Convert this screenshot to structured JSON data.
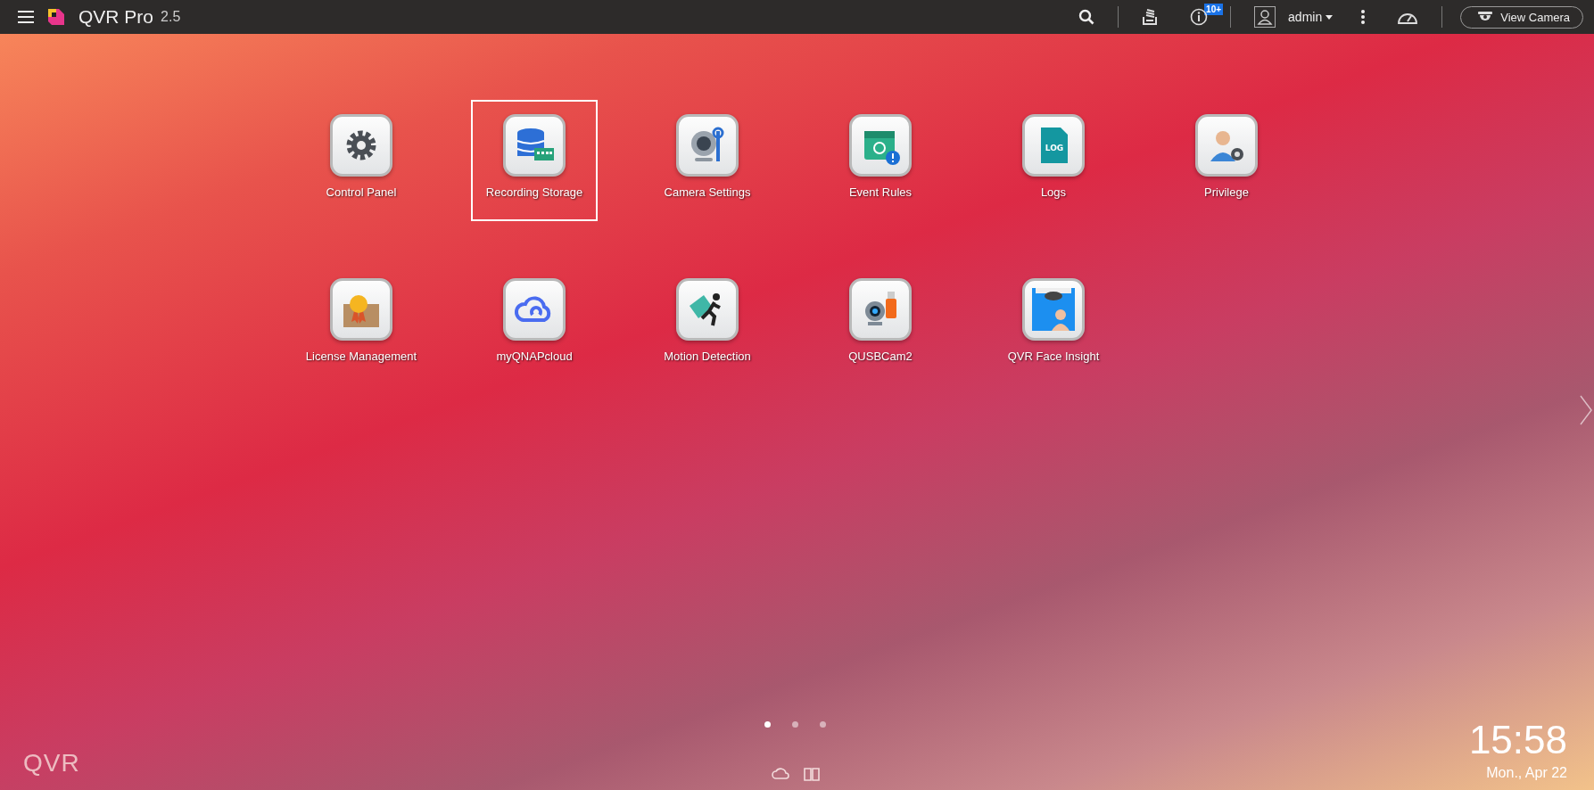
{
  "topbar": {
    "app_name": "QVR Pro",
    "version": "2.5",
    "notification_badge": "10+",
    "user": "admin",
    "view_camera_button": "View Camera"
  },
  "apps": [
    {
      "label": "Control Panel",
      "kind": "gear",
      "selected": false
    },
    {
      "label": "Recording Storage",
      "kind": "database",
      "selected": true
    },
    {
      "label": "Camera Settings",
      "kind": "camera-wrench",
      "selected": false
    },
    {
      "label": "Event Rules",
      "kind": "calendar",
      "selected": false
    },
    {
      "label": "Logs",
      "kind": "log",
      "icon_text": "LOG",
      "selected": false
    },
    {
      "label": "Privilege",
      "kind": "user-gear",
      "selected": false
    },
    {
      "label": "License Management",
      "kind": "certificate",
      "selected": false
    },
    {
      "label": "myQNAPcloud",
      "kind": "cloud",
      "selected": false
    },
    {
      "label": "Motion Detection",
      "kind": "runner",
      "selected": false
    },
    {
      "label": "QUSBCam2",
      "kind": "usb-cam",
      "selected": false
    },
    {
      "label": "QVR Face Insight",
      "kind": "face-scan",
      "selected": false
    }
  ],
  "pages": [
    {
      "selected": true
    },
    {
      "selected": false
    },
    {
      "selected": false
    }
  ],
  "brand_mark": "QVR",
  "clock": {
    "time": "15:58",
    "date": "Mon., Apr 22"
  }
}
